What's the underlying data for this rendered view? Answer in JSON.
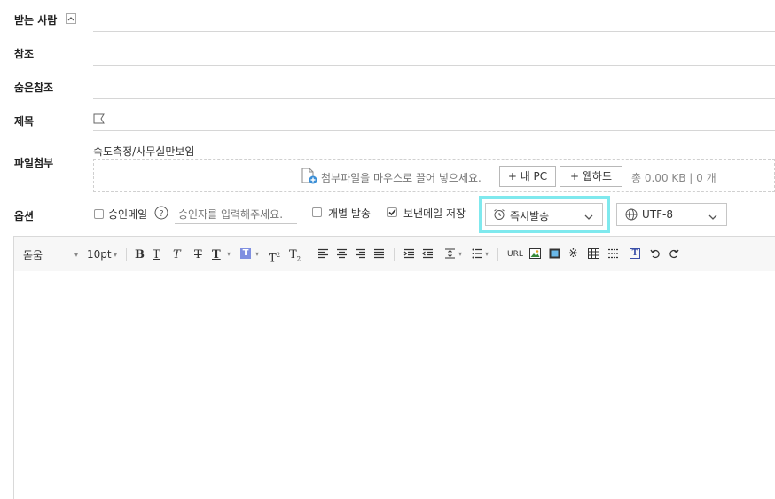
{
  "fields": {
    "to_label": "받는 사람",
    "cc_label": "참조",
    "bcc_label": "숨은참조",
    "subject_label": "제목",
    "attach_label": "파일첨부",
    "options_label": "옵션"
  },
  "attachment": {
    "folder_text": "속도측정/사무실만보임",
    "drop_hint": "첨부파일을 마우스로 끌어 넣으세요.",
    "my_pc_button": "+ 내 PC",
    "webhard_button": "+ 웹하드",
    "total": "총 0.00 KB | 0 개"
  },
  "options": {
    "approval_label": "승인메일",
    "approver_placeholder": "승인자를 입력해주세요.",
    "individual_send_label": "개별 발송",
    "save_sent_label": "보낸메일 저장",
    "send_time_value": "즉시발송",
    "encoding_value": "UTF-8",
    "highlight_color": "#7fe9ee"
  },
  "toolbar": {
    "font_value": "돋움",
    "size_value": "10pt",
    "url_label": "URL"
  }
}
